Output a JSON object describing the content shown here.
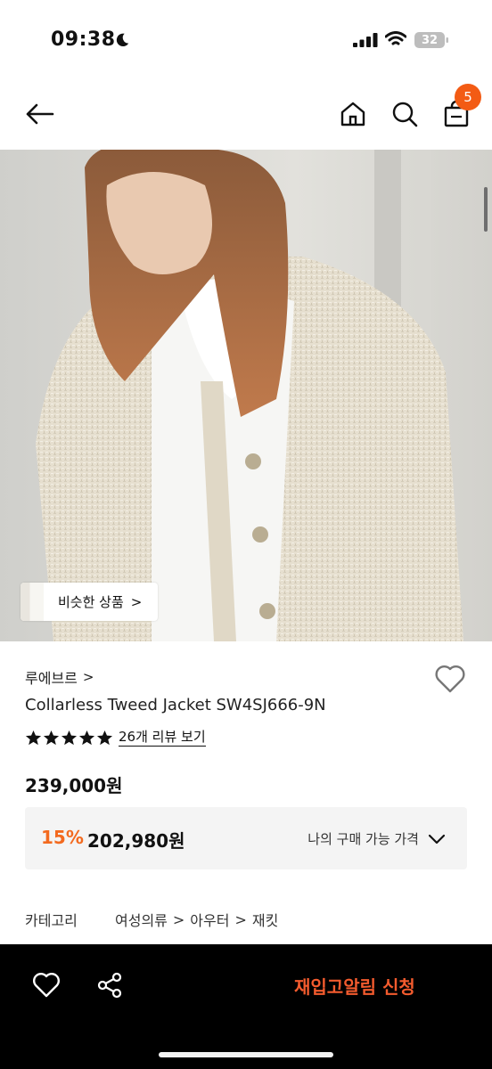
{
  "status_bar": {
    "time": "09:38",
    "battery": "32"
  },
  "nav": {
    "cart_count": "5"
  },
  "hero": {
    "similar_label": "비슷한 상품"
  },
  "product": {
    "brand": "루에브르",
    "name": "Collarless Tweed Jacket SW4SJ666-9N",
    "rating_stars": 5,
    "review_link": "26개 리뷰 보기",
    "price": "239,000원",
    "discount": "15%",
    "sale_price": "202,980원",
    "my_price_label": "나의 구매 가능 가격"
  },
  "category": {
    "label": "카테고리",
    "path": [
      "여성의류",
      "아우터",
      "재킷"
    ]
  },
  "bottom_bar": {
    "restock_label": "재입고알림 신청"
  },
  "colors": {
    "accent": "#f35b14",
    "discount": "#f36a1f",
    "restock": "#f35b2e"
  },
  "icons": {
    "back": "arrow-left-icon",
    "home": "home-icon",
    "search": "search-icon",
    "cart": "shopping-bag-icon",
    "wishlist": "heart-icon",
    "share": "share-icon"
  }
}
